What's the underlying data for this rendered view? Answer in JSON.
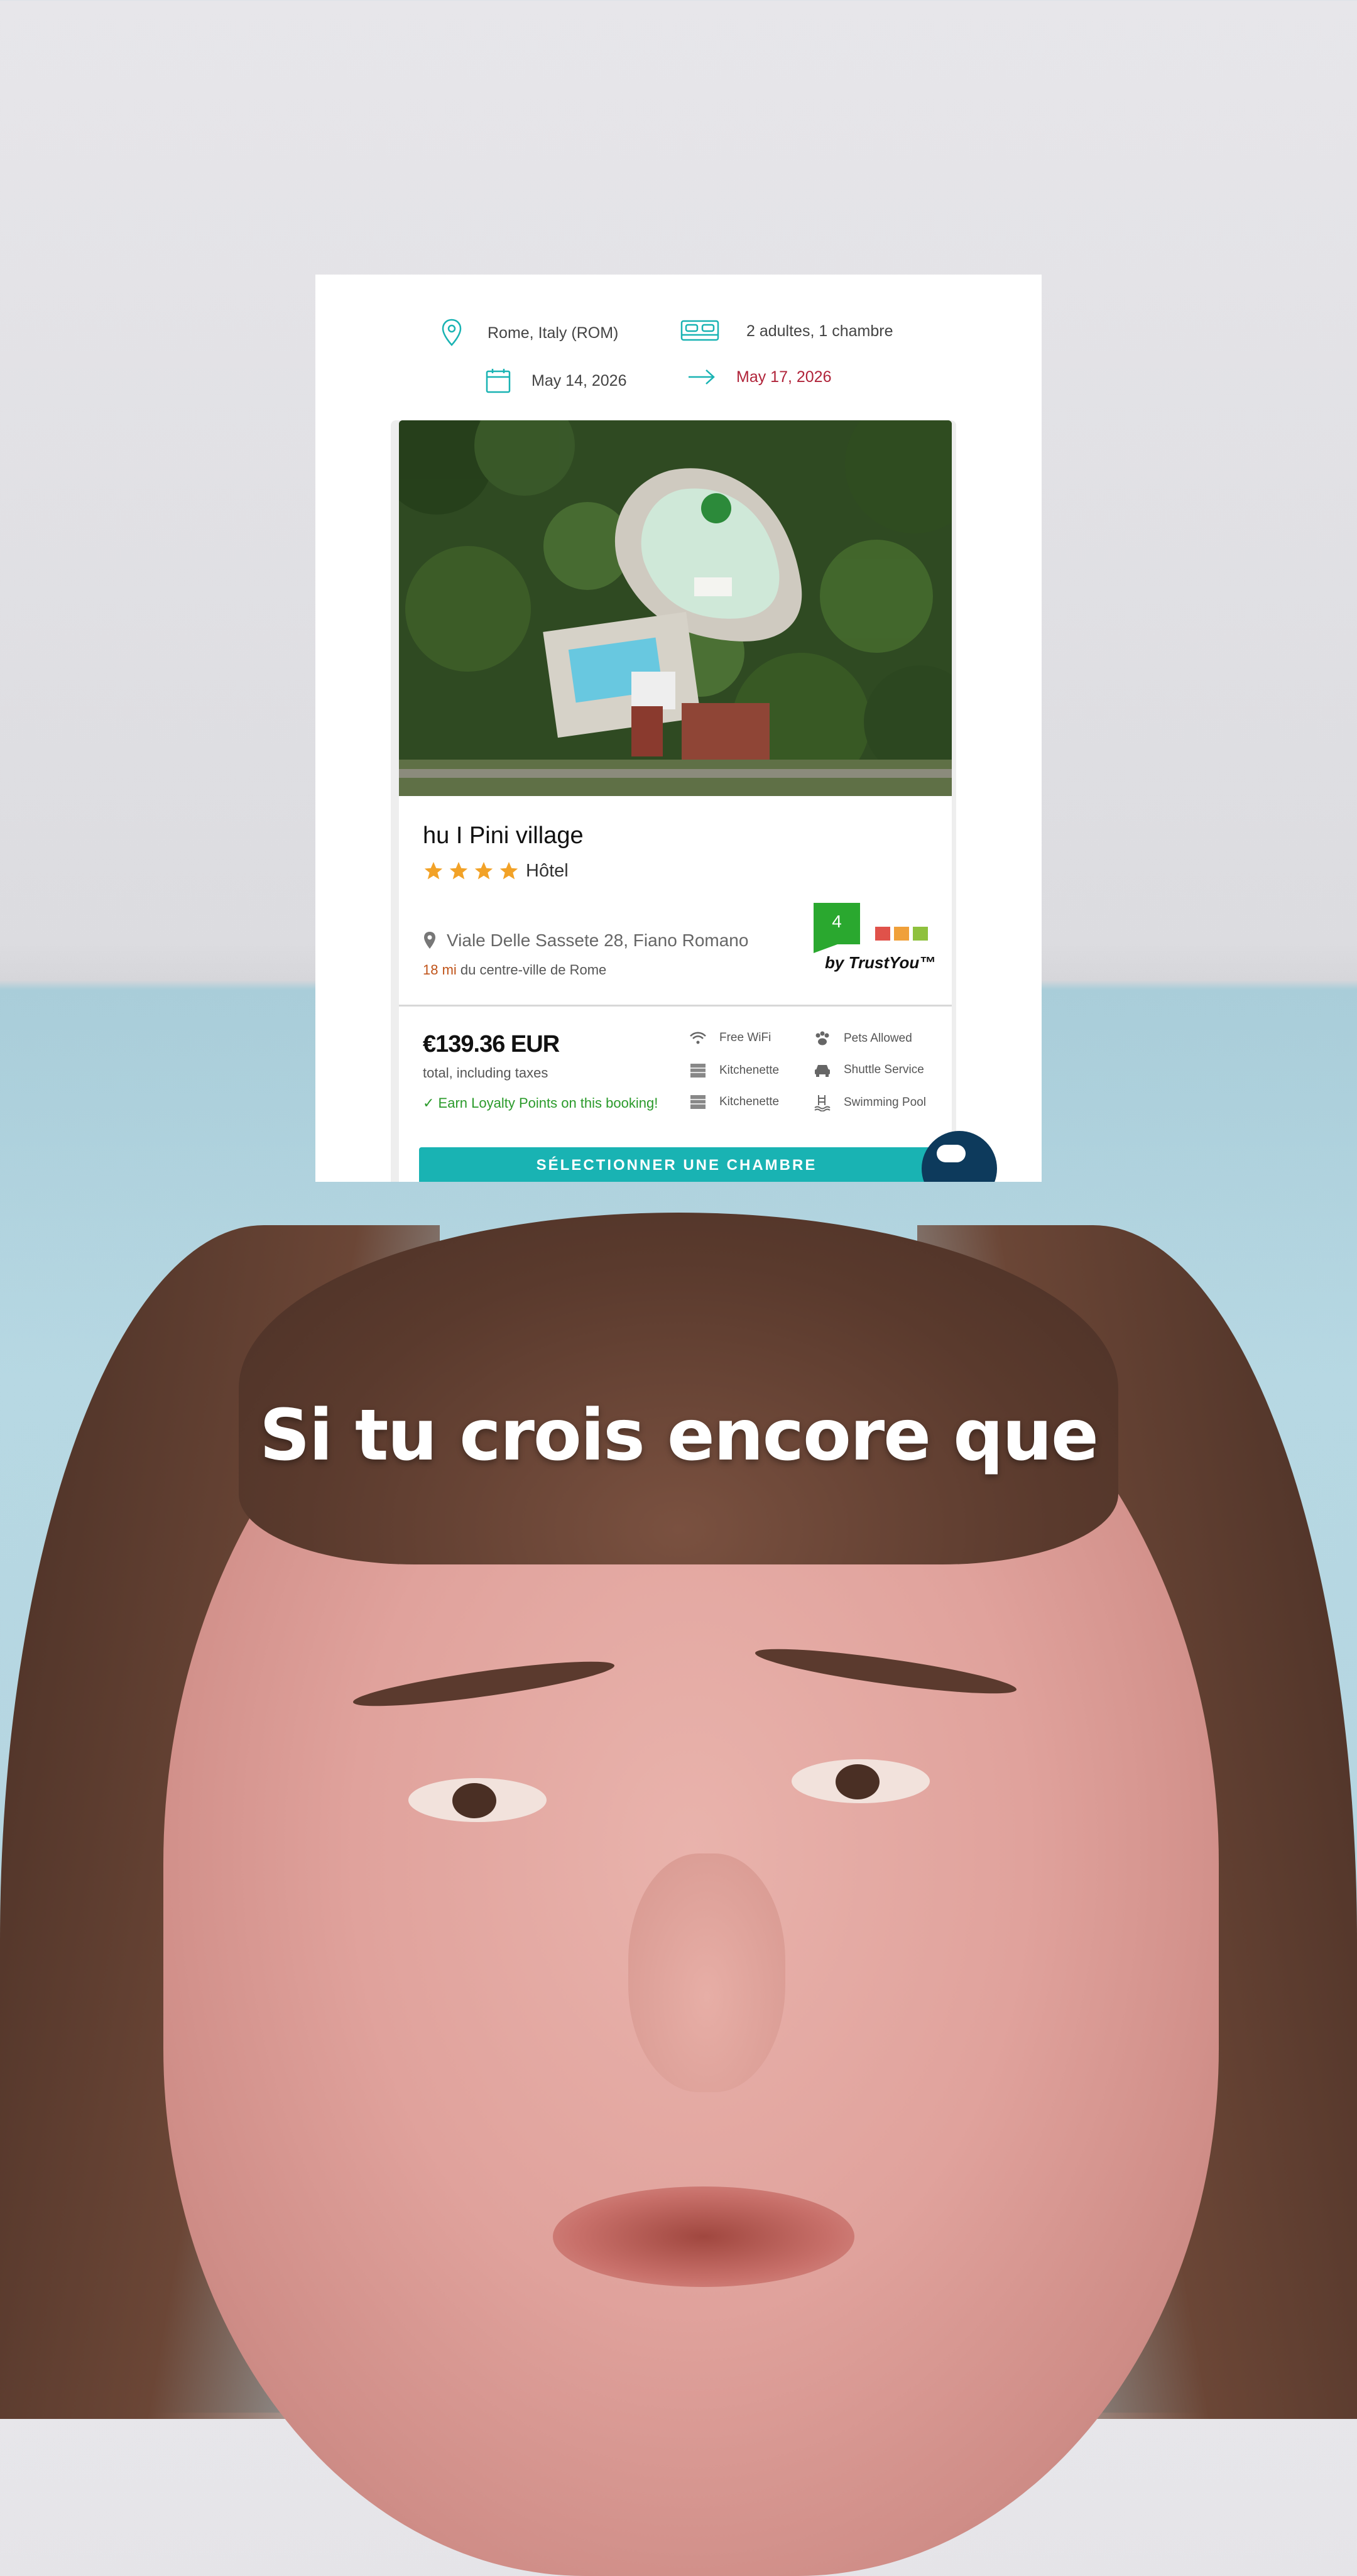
{
  "search": {
    "location": "Rome, Italy (ROM)",
    "guests": "2 adultes, 1 chambre",
    "checkin": "May 14, 2026",
    "checkout": "May 17, 2026"
  },
  "hotel": {
    "name": "hu I Pini village",
    "stars": 4,
    "type": "Hôtel",
    "address": "Viale Delle Sassete 28, Fiano Romano",
    "distance_value": "18 mi",
    "distance_label": "du centre-ville de Rome",
    "trust_score": "4",
    "trust_by": "by TrustYou™",
    "price": "€139.36 EUR",
    "price_sub": "total, including taxes",
    "loyalty": "✓ Earn Loyalty Points on this booking!",
    "amenities": [
      "Free WiFi",
      "Pets Allowed",
      "Kitchenette",
      "Shuttle Service",
      "Kitchenette",
      "Swimming Pool"
    ],
    "cta": "SÉLECTIONNER UNE CHAMBRE"
  },
  "caption": "Si tu crois encore que",
  "colors": {
    "accent": "#19b3b3",
    "checkout_date": "#b0243a",
    "star": "#f2a227",
    "trust_green": "#2aa82f",
    "loyalty": "#2a9a2a",
    "distance": "#c0541a"
  },
  "icons": [
    "map-pin-icon",
    "bed-icon",
    "calendar-icon",
    "arrow-right-icon",
    "star-icon",
    "location-pin-icon",
    "wifi-icon",
    "paw-icon",
    "kitchenette-icon",
    "car-icon",
    "pool-icon",
    "chat-icon"
  ]
}
